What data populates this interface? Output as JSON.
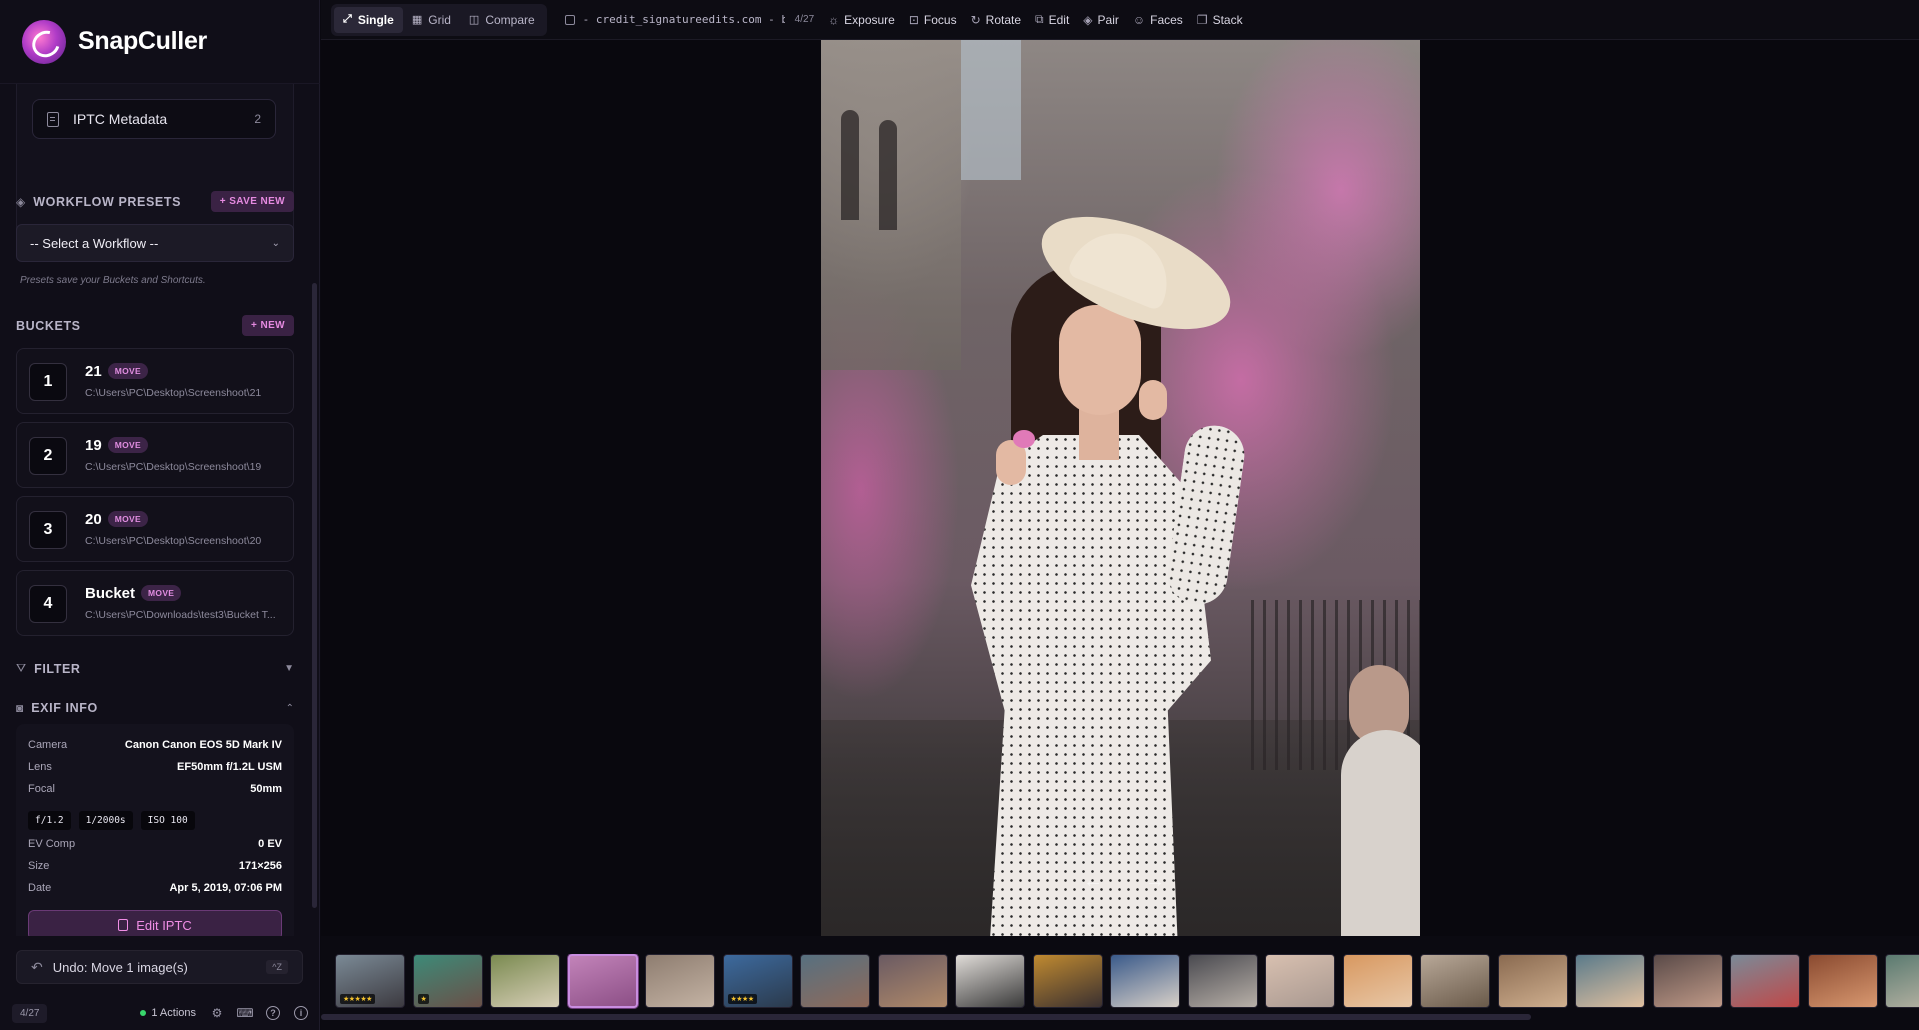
{
  "brand": {
    "name": "SnapCuller"
  },
  "iptc": {
    "label": "IPTC Metadata",
    "count": "2"
  },
  "workflow": {
    "title": "WORKFLOW PRESETS",
    "save_label": "+ SAVE NEW",
    "select_value": "-- Select a Workflow --",
    "hint": "Presets save your Buckets and Shortcuts."
  },
  "buckets": {
    "title": "BUCKETS",
    "new_label": "+ NEW",
    "items": [
      {
        "num": "1",
        "name": "21",
        "badge": "MOVE",
        "path": "C:\\Users\\PC\\Desktop\\Screenshoot\\21"
      },
      {
        "num": "2",
        "name": "19",
        "badge": "MOVE",
        "path": "C:\\Users\\PC\\Desktop\\Screenshoot\\19"
      },
      {
        "num": "3",
        "name": "20",
        "badge": "MOVE",
        "path": "C:\\Users\\PC\\Desktop\\Screenshoot\\20"
      },
      {
        "num": "4",
        "name": "Bucket",
        "badge": "MOVE",
        "path": "C:\\Users\\PC\\Downloads\\test3\\Bucket T..."
      }
    ]
  },
  "filter": {
    "title": "FILTER",
    "caret": "▼"
  },
  "exif": {
    "title": "EXIF INFO",
    "caret": "⌃",
    "camera_k": "Camera",
    "camera_v": "Canon Canon EOS 5D Mark IV",
    "lens_k": "Lens",
    "lens_v": "EF50mm f/1.2L USM",
    "focal_k": "Focal",
    "focal_v": "50mm",
    "aperture": "f/1.2",
    "shutter": "1/2000s",
    "iso": "ISO 100",
    "ev_k": "EV Comp",
    "ev_v": "0 EV",
    "size_k": "Size",
    "size_v": "171×256",
    "date_k": "Date",
    "date_v": "Apr 5, 2019, 07:06 PM",
    "edit_label": "Edit IPTC"
  },
  "undo": {
    "label": "Undo: Move 1 image(s)",
    "shortcut": "^Z"
  },
  "status": {
    "counter": "4/27",
    "actions": "1 Actions"
  },
  "toolbar": {
    "views": [
      "Single",
      "Grid",
      "Compare"
    ],
    "filename": "- credit_signatureedits.com - bo…",
    "position": "4/27",
    "tools": [
      "Exposure",
      "Focus",
      "Rotate",
      "Edit",
      "Pair",
      "Faces",
      "Stack"
    ]
  },
  "filmstrip": {
    "selected_index": 3,
    "thumbs": [
      {
        "colors": [
          "#7b8a96",
          "#3c3a40"
        ],
        "stars": "★★★★★"
      },
      {
        "colors": [
          "#3d8a78",
          "#6a5048"
        ],
        "stars": "★"
      },
      {
        "colors": [
          "#7a8a50",
          "#d8cfb8"
        ],
        "stars": ""
      },
      {
        "colors": [
          "#c283b9",
          "#8c4f86"
        ],
        "stars": ""
      },
      {
        "colors": [
          "#8e7d70",
          "#c4b3a4"
        ],
        "stars": ""
      },
      {
        "colors": [
          "#3d6a9e",
          "#2b3a4c"
        ],
        "stars": "★★★★"
      },
      {
        "colors": [
          "#577080",
          "#8f6a5a"
        ],
        "stars": ""
      },
      {
        "colors": [
          "#6a5a62",
          "#b08a6a"
        ],
        "stars": ""
      },
      {
        "colors": [
          "#e0dcd8",
          "#3a3a3a"
        ],
        "stars": ""
      },
      {
        "colors": [
          "#c08a30",
          "#3a3030"
        ],
        "stars": ""
      },
      {
        "colors": [
          "#3a5a8a",
          "#d8d0c8"
        ],
        "stars": ""
      },
      {
        "colors": [
          "#4a4a50",
          "#b8b0a8"
        ],
        "stars": ""
      },
      {
        "colors": [
          "#d8c0b0",
          "#a89890"
        ],
        "stars": ""
      },
      {
        "colors": [
          "#d89860",
          "#e8c8a8"
        ],
        "stars": ""
      },
      {
        "colors": [
          "#b8a898",
          "#6a5a4a"
        ],
        "stars": ""
      },
      {
        "colors": [
          "#8a6a50",
          "#d0b090"
        ],
        "stars": ""
      },
      {
        "colors": [
          "#5a7a8a",
          "#e0c0a0"
        ],
        "stars": ""
      },
      {
        "colors": [
          "#5a4a48",
          "#c09a88"
        ],
        "stars": ""
      },
      {
        "colors": [
          "#7a8a98",
          "#c04848"
        ],
        "stars": ""
      },
      {
        "colors": [
          "#8a4a30",
          "#d89870"
        ],
        "stars": ""
      },
      {
        "colors": [
          "#5a7a70",
          "#c0b8a8"
        ],
        "stars": ""
      }
    ]
  }
}
